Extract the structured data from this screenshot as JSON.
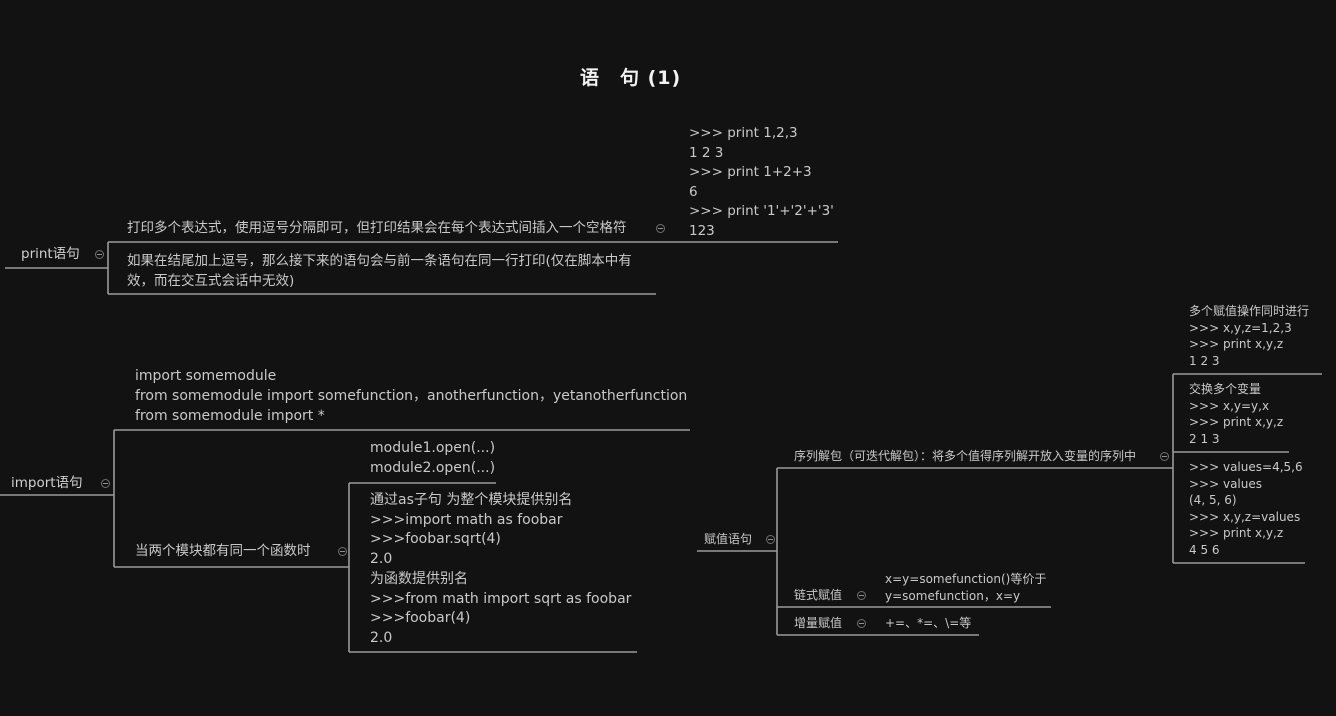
{
  "title": "语　句 (1)",
  "colors": {
    "background": "#121212",
    "line": "#9a9a9a",
    "text": "#c9c9c9",
    "title": "#f2f2f2"
  },
  "icons": {
    "collapse": "minus-circle-icon"
  },
  "print": {
    "label": "print语句",
    "expr_desc": "打印多个表达式，使用逗号分隔即可，但打印结果会在每个表达式间插入一个空格符",
    "expr_example": [
      ">>> print 1,2,3",
      "1 2 3",
      ">>> print 1+2+3",
      "6",
      ">>> print '1'+'2'+'3'",
      "123"
    ],
    "comma_desc": "如果在结尾加上逗号，那么接下来的语句会与前一条语句在同一行打印(仅在脚本中有效，而在交互式会话中无效)"
  },
  "import": {
    "label": "import语句",
    "forms": [
      "import somemodule",
      "from somemodule import somefunction，anotherfunction，yetanotherfunction",
      "from somemodule import *"
    ],
    "same_func_label": "当两个模块都有同一个函数时",
    "module_open": [
      "module1.open(...)",
      "module2.open(...)"
    ],
    "alias": [
      "通过as子句 为整个模块提供别名",
      ">>>import math as foobar",
      ">>>foobar.sqrt(4)",
      "2.0",
      "为函数提供别名",
      ">>>from math import sqrt as foobar",
      ">>>foobar(4)",
      "2.0"
    ]
  },
  "assign": {
    "label": "赋值语句",
    "unpack_label": "序列解包（可迭代解包）：将多个值得序列解开放入变量的序列中",
    "multi": [
      "多个赋值操作同时进行",
      ">>> x,y,z=1,2,3",
      ">>> print x,y,z",
      "1 2 3"
    ],
    "swap": [
      "交换多个变量",
      ">>> x,y=y,x",
      ">>> print x,y,z",
      "2 1 3"
    ],
    "values": [
      ">>> values=4,5,6",
      ">>> values",
      "(4, 5, 6)",
      ">>> x,y,z=values",
      ">>> print x,y,z",
      "4 5 6"
    ],
    "chain_label": "链式赋值",
    "chain_desc": [
      "x=y=somefunction()等价于",
      "y=somefunction，x=y"
    ],
    "aug_label": "增量赋值",
    "aug_desc": "+=、*=、\\=等"
  }
}
